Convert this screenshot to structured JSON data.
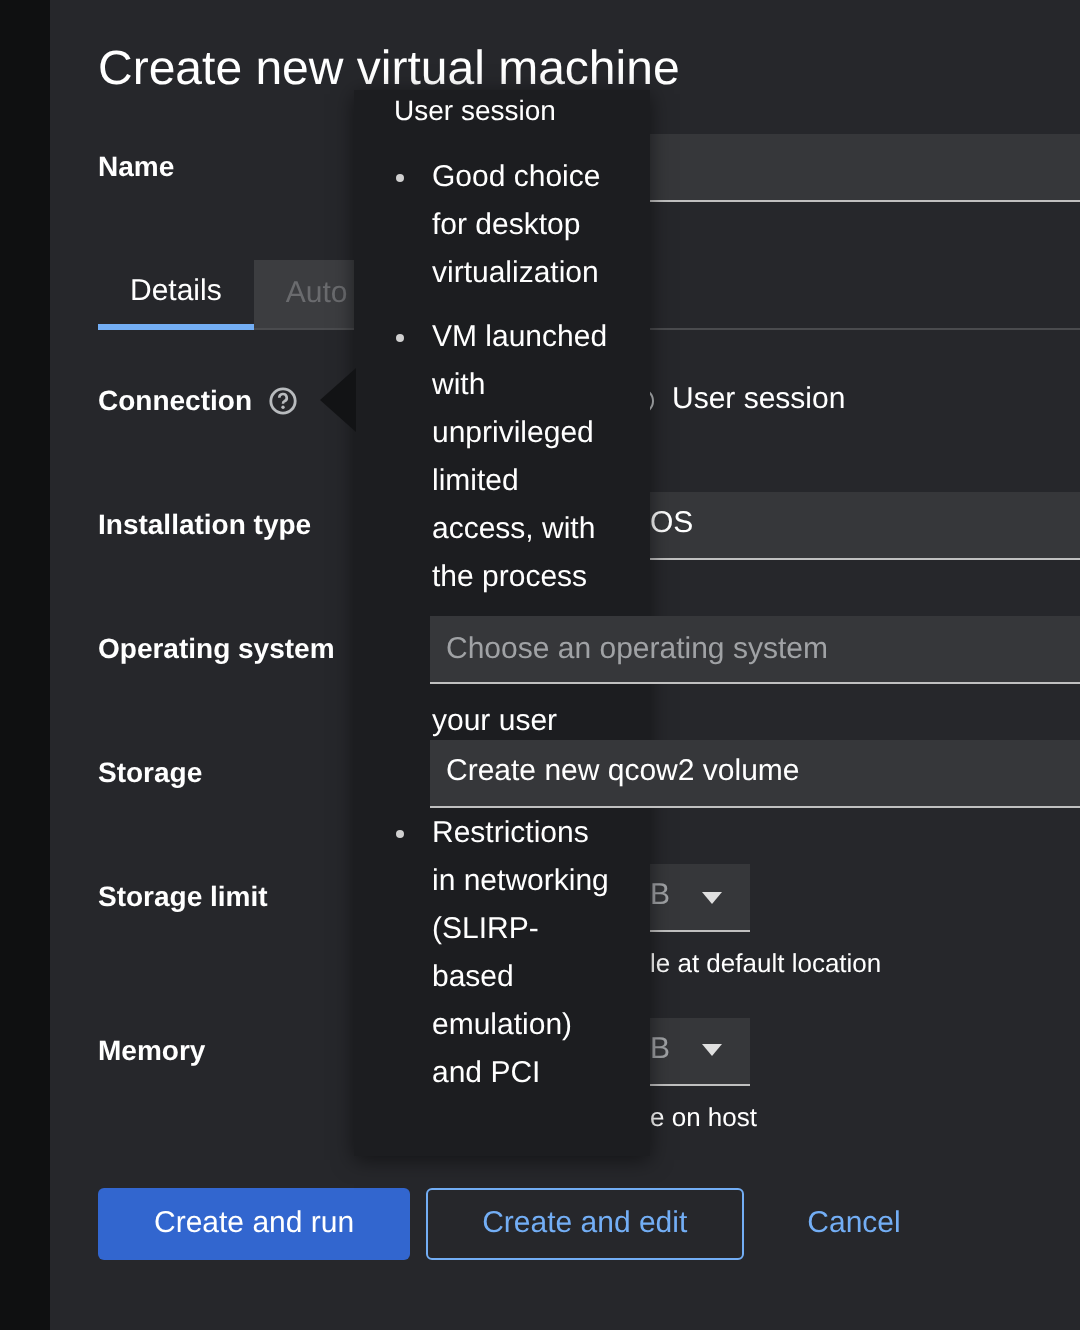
{
  "modal": {
    "title": "Create new virtual machine"
  },
  "name_field": {
    "label": "Name"
  },
  "tabs": [
    {
      "label": "Details",
      "selected": true
    },
    {
      "label": "Auto",
      "selected": false
    }
  ],
  "connection": {
    "label": "Connection",
    "option": {
      "label": "User session",
      "selected": false
    }
  },
  "installation_type": {
    "label": "Installation type",
    "value": "OS"
  },
  "operating_system": {
    "label": "Operating system",
    "placeholder": "Choose an operating system"
  },
  "storage": {
    "label": "Storage",
    "value": "Create new qcow2 volume"
  },
  "storage_limit": {
    "label": "Storage limit",
    "unit": "B",
    "helper": "le at default location"
  },
  "memory": {
    "label": "Memory",
    "unit": "B",
    "helper": "e on host"
  },
  "popover": {
    "title": "User session",
    "items": [
      {
        "text": "Good choice for desktop virtualization"
      },
      {
        "text": "VM launched with unprivileged limited access, with the process",
        "continuation": "your user"
      },
      {
        "text": "Restrictions in networking (SLIRP-based emulation) and PCI"
      }
    ]
  },
  "buttons": [
    {
      "label": "Create and run",
      "kind": "primary"
    },
    {
      "label": "Create and edit",
      "kind": "secondary"
    },
    {
      "label": "Cancel",
      "kind": "link"
    }
  ]
}
